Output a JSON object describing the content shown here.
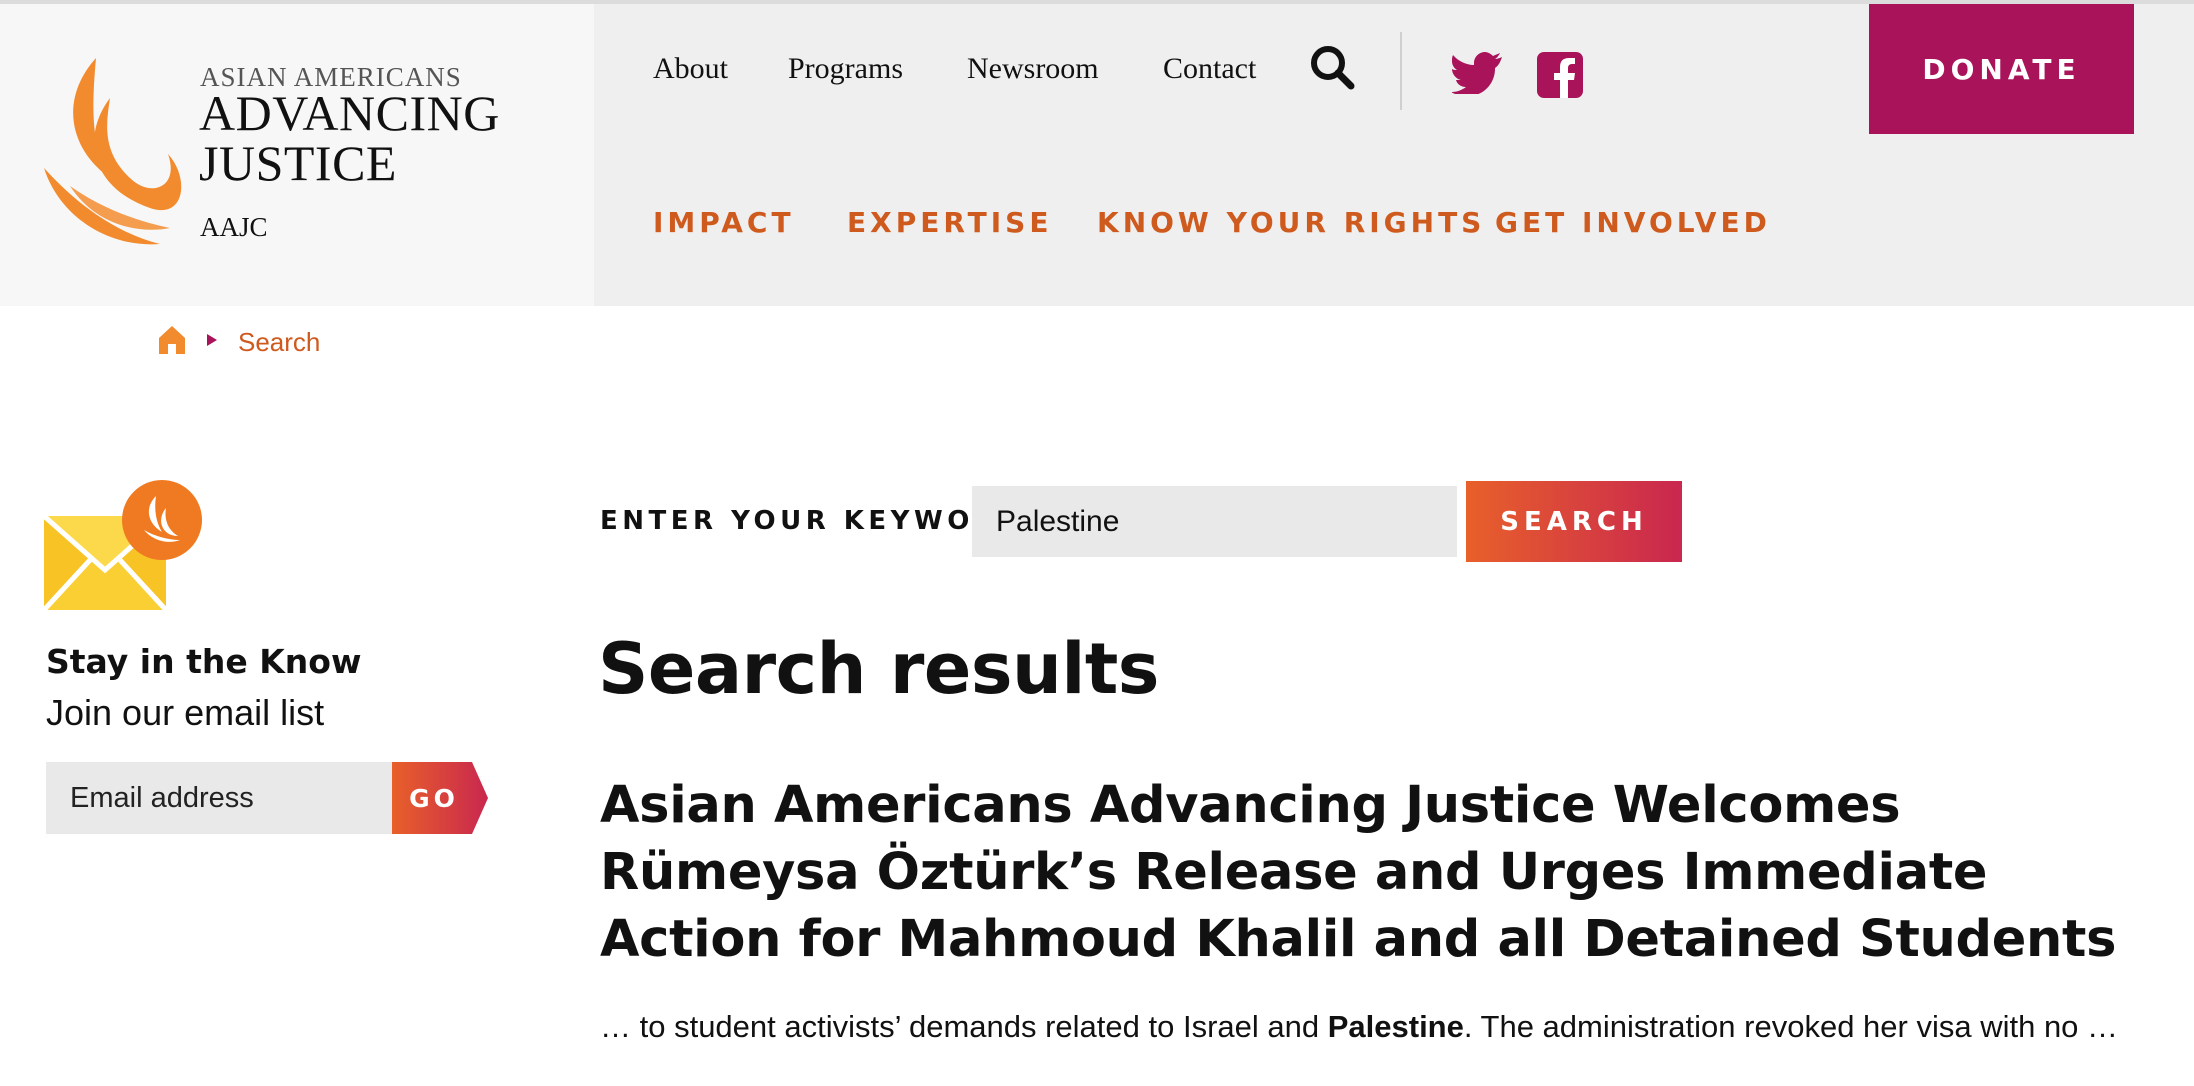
{
  "header": {
    "logo": {
      "line_small": "ASIAN AMERICANS",
      "line_big_1": "ADVANCING",
      "line_big_2": "JUSTICE",
      "abbr": "AAJC",
      "color": "#f28a2e"
    },
    "utility_nav": [
      "About",
      "Programs",
      "Newsroom",
      "Contact"
    ],
    "search_icon": "search-icon",
    "social": [
      "twitter-icon",
      "facebook-icon"
    ],
    "donate_label": "DONATE",
    "main_nav": [
      "IMPACT",
      "EXPERTISE",
      "KNOW YOUR RIGHTS",
      "GET INVOLVED"
    ],
    "colors": {
      "accent_orange": "#cf5a1e",
      "brand_magenta": "#a9135a"
    }
  },
  "breadcrumb": {
    "home_icon": "home-icon",
    "current": "Search"
  },
  "sidebar": {
    "newsletter": {
      "icon": "envelope-icon",
      "title": "Stay in the Know",
      "subtitle": "Join our email list",
      "email_placeholder": "Email address",
      "go_label": "GO"
    }
  },
  "search": {
    "label": "ENTER YOUR KEYWORDS",
    "value": "Palestine",
    "button_label": "SEARCH"
  },
  "results": {
    "heading": "Search results",
    "items": [
      {
        "title": "Asian Americans Advancing Justice Welcomes Rümeysa Öztürk’s Release and Urges Immediate Action for Mahmoud Khalil and all Detained Students",
        "snippet_before": "… to student activists’ demands related to Israel and ",
        "snippet_highlight": "Palestine",
        "snippet_after": ". The administration revoked her visa with no …"
      }
    ]
  }
}
